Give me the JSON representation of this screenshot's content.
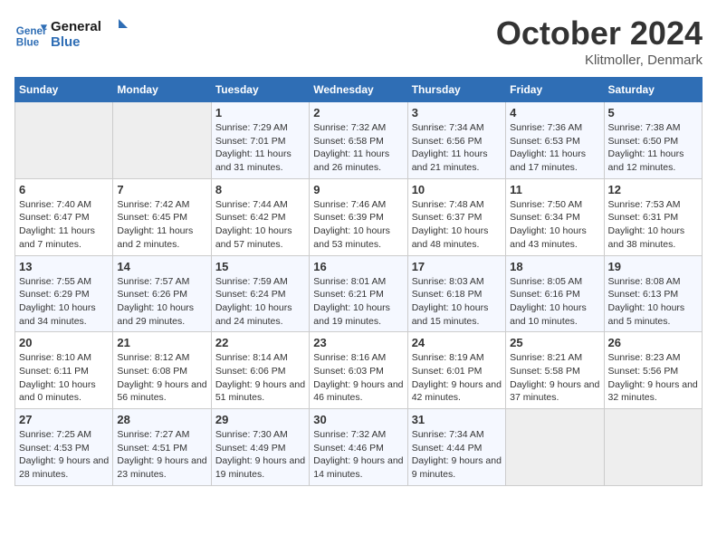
{
  "header": {
    "logo_line1": "General",
    "logo_line2": "Blue",
    "month": "October 2024",
    "location": "Klitmoller, Denmark"
  },
  "weekdays": [
    "Sunday",
    "Monday",
    "Tuesday",
    "Wednesday",
    "Thursday",
    "Friday",
    "Saturday"
  ],
  "weeks": [
    [
      {
        "day": "",
        "info": ""
      },
      {
        "day": "",
        "info": ""
      },
      {
        "day": "1",
        "info": "Sunrise: 7:29 AM\nSunset: 7:01 PM\nDaylight: 11 hours and 31 minutes."
      },
      {
        "day": "2",
        "info": "Sunrise: 7:32 AM\nSunset: 6:58 PM\nDaylight: 11 hours and 26 minutes."
      },
      {
        "day": "3",
        "info": "Sunrise: 7:34 AM\nSunset: 6:56 PM\nDaylight: 11 hours and 21 minutes."
      },
      {
        "day": "4",
        "info": "Sunrise: 7:36 AM\nSunset: 6:53 PM\nDaylight: 11 hours and 17 minutes."
      },
      {
        "day": "5",
        "info": "Sunrise: 7:38 AM\nSunset: 6:50 PM\nDaylight: 11 hours and 12 minutes."
      }
    ],
    [
      {
        "day": "6",
        "info": "Sunrise: 7:40 AM\nSunset: 6:47 PM\nDaylight: 11 hours and 7 minutes."
      },
      {
        "day": "7",
        "info": "Sunrise: 7:42 AM\nSunset: 6:45 PM\nDaylight: 11 hours and 2 minutes."
      },
      {
        "day": "8",
        "info": "Sunrise: 7:44 AM\nSunset: 6:42 PM\nDaylight: 10 hours and 57 minutes."
      },
      {
        "day": "9",
        "info": "Sunrise: 7:46 AM\nSunset: 6:39 PM\nDaylight: 10 hours and 53 minutes."
      },
      {
        "day": "10",
        "info": "Sunrise: 7:48 AM\nSunset: 6:37 PM\nDaylight: 10 hours and 48 minutes."
      },
      {
        "day": "11",
        "info": "Sunrise: 7:50 AM\nSunset: 6:34 PM\nDaylight: 10 hours and 43 minutes."
      },
      {
        "day": "12",
        "info": "Sunrise: 7:53 AM\nSunset: 6:31 PM\nDaylight: 10 hours and 38 minutes."
      }
    ],
    [
      {
        "day": "13",
        "info": "Sunrise: 7:55 AM\nSunset: 6:29 PM\nDaylight: 10 hours and 34 minutes."
      },
      {
        "day": "14",
        "info": "Sunrise: 7:57 AM\nSunset: 6:26 PM\nDaylight: 10 hours and 29 minutes."
      },
      {
        "day": "15",
        "info": "Sunrise: 7:59 AM\nSunset: 6:24 PM\nDaylight: 10 hours and 24 minutes."
      },
      {
        "day": "16",
        "info": "Sunrise: 8:01 AM\nSunset: 6:21 PM\nDaylight: 10 hours and 19 minutes."
      },
      {
        "day": "17",
        "info": "Sunrise: 8:03 AM\nSunset: 6:18 PM\nDaylight: 10 hours and 15 minutes."
      },
      {
        "day": "18",
        "info": "Sunrise: 8:05 AM\nSunset: 6:16 PM\nDaylight: 10 hours and 10 minutes."
      },
      {
        "day": "19",
        "info": "Sunrise: 8:08 AM\nSunset: 6:13 PM\nDaylight: 10 hours and 5 minutes."
      }
    ],
    [
      {
        "day": "20",
        "info": "Sunrise: 8:10 AM\nSunset: 6:11 PM\nDaylight: 10 hours and 0 minutes."
      },
      {
        "day": "21",
        "info": "Sunrise: 8:12 AM\nSunset: 6:08 PM\nDaylight: 9 hours and 56 minutes."
      },
      {
        "day": "22",
        "info": "Sunrise: 8:14 AM\nSunset: 6:06 PM\nDaylight: 9 hours and 51 minutes."
      },
      {
        "day": "23",
        "info": "Sunrise: 8:16 AM\nSunset: 6:03 PM\nDaylight: 9 hours and 46 minutes."
      },
      {
        "day": "24",
        "info": "Sunrise: 8:19 AM\nSunset: 6:01 PM\nDaylight: 9 hours and 42 minutes."
      },
      {
        "day": "25",
        "info": "Sunrise: 8:21 AM\nSunset: 5:58 PM\nDaylight: 9 hours and 37 minutes."
      },
      {
        "day": "26",
        "info": "Sunrise: 8:23 AM\nSunset: 5:56 PM\nDaylight: 9 hours and 32 minutes."
      }
    ],
    [
      {
        "day": "27",
        "info": "Sunrise: 7:25 AM\nSunset: 4:53 PM\nDaylight: 9 hours and 28 minutes."
      },
      {
        "day": "28",
        "info": "Sunrise: 7:27 AM\nSunset: 4:51 PM\nDaylight: 9 hours and 23 minutes."
      },
      {
        "day": "29",
        "info": "Sunrise: 7:30 AM\nSunset: 4:49 PM\nDaylight: 9 hours and 19 minutes."
      },
      {
        "day": "30",
        "info": "Sunrise: 7:32 AM\nSunset: 4:46 PM\nDaylight: 9 hours and 14 minutes."
      },
      {
        "day": "31",
        "info": "Sunrise: 7:34 AM\nSunset: 4:44 PM\nDaylight: 9 hours and 9 minutes."
      },
      {
        "day": "",
        "info": ""
      },
      {
        "day": "",
        "info": ""
      }
    ]
  ]
}
